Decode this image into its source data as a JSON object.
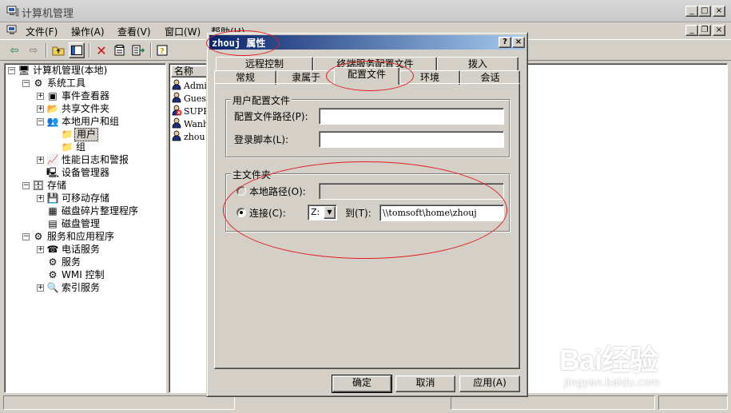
{
  "main_window": {
    "title": "计算机管理",
    "menu": [
      "文件(F)",
      "操作(A)",
      "查看(V)",
      "窗口(W)",
      "帮助(H)"
    ]
  },
  "toolbar_icons": [
    "back-arrow-icon",
    "forward-arrow-icon",
    "up-folder-icon",
    "show-tree-icon",
    "delete-icon",
    "properties-icon",
    "export-icon",
    "help-icon"
  ],
  "tree": [
    {
      "label": "计算机管理(本地)",
      "level": 0,
      "expander": "-",
      "icon": "computer-management-icon"
    },
    {
      "label": "系统工具",
      "level": 1,
      "expander": "-",
      "icon": "system-tools-icon"
    },
    {
      "label": "事件查看器",
      "level": 2,
      "expander": "+",
      "icon": "event-viewer-icon"
    },
    {
      "label": "共享文件夹",
      "level": 2,
      "expander": "+",
      "icon": "shared-folder-icon"
    },
    {
      "label": "本地用户和组",
      "level": 2,
      "expander": "-",
      "icon": "users-groups-icon"
    },
    {
      "label": "用户",
      "level": 3,
      "expander": "",
      "icon": "folder-icon",
      "selected": true
    },
    {
      "label": "组",
      "level": 3,
      "expander": "",
      "icon": "folder-icon"
    },
    {
      "label": "性能日志和警报",
      "level": 2,
      "expander": "+",
      "icon": "performance-icon"
    },
    {
      "label": "设备管理器",
      "level": 2,
      "expander": "",
      "icon": "device-manager-icon"
    },
    {
      "label": "存储",
      "level": 1,
      "expander": "-",
      "icon": "storage-icon"
    },
    {
      "label": "可移动存储",
      "level": 2,
      "expander": "+",
      "icon": "removable-storage-icon"
    },
    {
      "label": "磁盘碎片整理程序",
      "level": 2,
      "expander": "",
      "icon": "defrag-icon"
    },
    {
      "label": "磁盘管理",
      "level": 2,
      "expander": "",
      "icon": "disk-management-icon"
    },
    {
      "label": "服务和应用程序",
      "level": 1,
      "expander": "-",
      "icon": "services-apps-icon"
    },
    {
      "label": "电话服务",
      "level": 2,
      "expander": "+",
      "icon": "telephony-icon"
    },
    {
      "label": "服务",
      "level": 2,
      "expander": "",
      "icon": "services-icon"
    },
    {
      "label": "WMI 控制",
      "level": 2,
      "expander": "",
      "icon": "wmi-icon"
    },
    {
      "label": "索引服务",
      "level": 2,
      "expander": "+",
      "icon": "indexing-icon"
    }
  ],
  "list": {
    "header": "名称",
    "rows": [
      "Admin",
      "Guest",
      "SUPPO",
      "Wanh",
      "zhou"
    ]
  },
  "dialog": {
    "title": "zhouj 属性",
    "tabs_back": [
      "远程控制",
      "终端服务配置文件",
      "拨入"
    ],
    "tabs_front": [
      "常规",
      "隶属于",
      "配置文件",
      "环境",
      "会话"
    ],
    "active_tab": "配置文件",
    "user_profile_group": "用户配置文件",
    "profile_path_label": "配置文件路径(P):",
    "profile_path_value": "",
    "logon_script_label": "登录脚本(L):",
    "logon_script_value": "",
    "home_folder_group": "主文件夹",
    "local_path_label": "本地路径(O):",
    "local_path_value": "",
    "connect_label": "连接(C):",
    "drive_value": "Z:",
    "to_label": "到(T):",
    "home_path_value": "\\\\tomsoft\\home\\zhouj",
    "ok": "确定",
    "cancel": "取消",
    "apply": "应用(A)",
    "help_btn": "?",
    "close_btn": "×"
  },
  "watermark": {
    "logo": "Bai经验",
    "url": "jingyan.baidu.com"
  },
  "colors": {
    "title_bar_start": "#0a246a",
    "title_bar_end": "#a6caf0",
    "annotation": "#e02020"
  }
}
